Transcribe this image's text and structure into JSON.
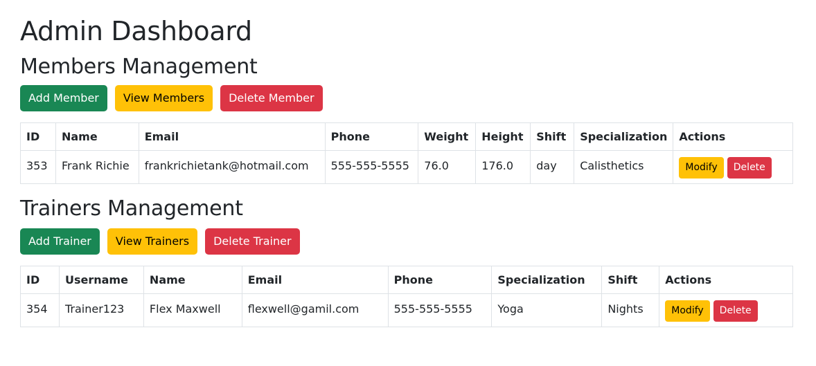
{
  "page": {
    "title": "Admin Dashboard"
  },
  "members": {
    "title": "Members Management",
    "buttons": {
      "add": "Add Member",
      "view": "View Members",
      "delete": "Delete Member"
    },
    "columns": [
      "ID",
      "Name",
      "Email",
      "Phone",
      "Weight",
      "Height",
      "Shift",
      "Specialization",
      "Actions"
    ],
    "rows": [
      {
        "id": "353",
        "name": "Frank Richie",
        "email": "frankrichietank@hotmail.com",
        "phone": "555-555-5555",
        "weight": "76.0",
        "height": "176.0",
        "shift": "day",
        "specialization": "Calisthetics",
        "modify": "Modify",
        "delete": "Delete"
      }
    ]
  },
  "trainers": {
    "title": "Trainers Management",
    "buttons": {
      "add": "Add Trainer",
      "view": "View Trainers",
      "delete": "Delete Trainer"
    },
    "columns": [
      "ID",
      "Username",
      "Name",
      "Email",
      "Phone",
      "Specialization",
      "Shift",
      "Actions"
    ],
    "rows": [
      {
        "id": "354",
        "username": "Trainer123",
        "name": "Flex Maxwell",
        "email": "flexwell@gamil.com",
        "phone": "555-555-5555",
        "specialization": "Yoga",
        "shift": "Nights",
        "modify": "Modify",
        "delete": "Delete"
      }
    ]
  },
  "colors": {
    "success": "#198754",
    "warning": "#ffc107",
    "danger": "#dc3545",
    "border": "#dee2e6"
  }
}
